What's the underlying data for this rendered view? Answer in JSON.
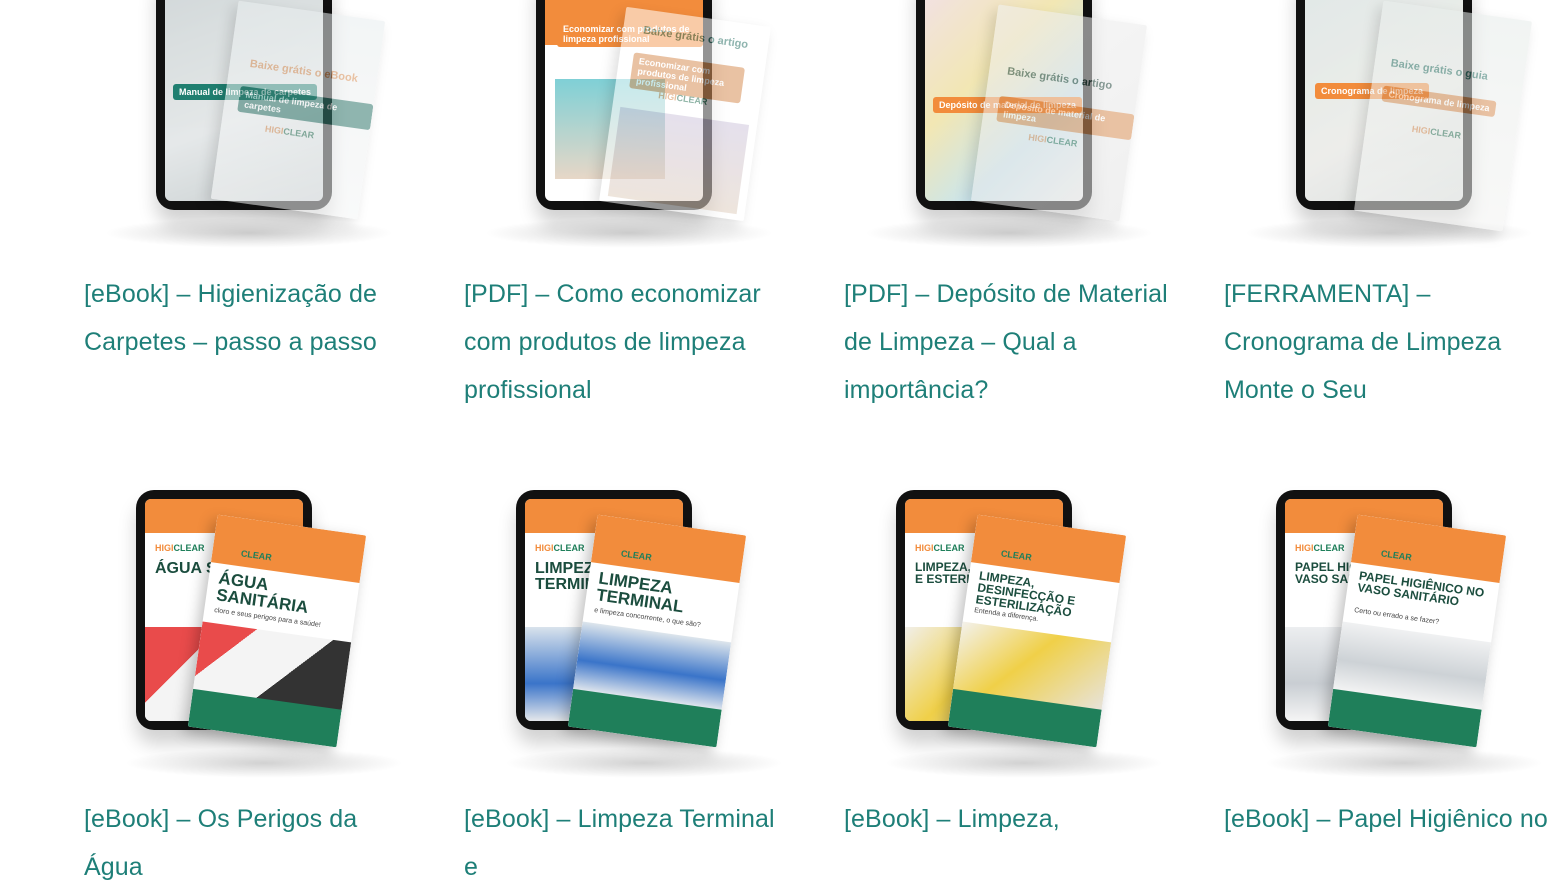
{
  "cards": [
    {
      "title": "[eBook] – Higienização de Carpetes – passo a passo",
      "cover": {
        "headline": "Baixe grátis o eBook",
        "sub": "Manual de limpeza de carpetes",
        "brand_a": "HIGI",
        "brand_b": "CLEAR"
      }
    },
    {
      "title": "[PDF] – Como economizar com produtos de limpeza profissional",
      "cover": {
        "headline": "Baixe grátis o artigo",
        "sub": "Economizar com produtos de limpeza profissional",
        "brand_a": "HIGI",
        "brand_b": "CLEAR"
      }
    },
    {
      "title": "[PDF] – Depósito de Material de Limpeza – Qual a importância?",
      "cover": {
        "headline": "Baixe grátis o artigo",
        "sub": "Depósito de material de limpeza",
        "brand_a": "HIGI",
        "brand_b": "CLEAR"
      }
    },
    {
      "title": "[FERRAMENTA] – Cronograma de Limpeza Monte o Seu",
      "cover": {
        "headline": "Baixe grátis o guia",
        "sub": "Cronograma de limpeza",
        "brand_a": "HIGI",
        "brand_b": "CLEAR"
      }
    },
    {
      "title": "[eBook] – Os Perigos da Água",
      "cover": {
        "headline": "Água Sanitária",
        "sub": "cloro e seus perigos para a saúde!",
        "brand_a": "HIGI",
        "brand_b": "CLEAR"
      }
    },
    {
      "title": "[eBook] – Limpeza Terminal e",
      "cover": {
        "headline": "Limpeza Terminal",
        "sub": "e limpeza concorrente, o que são?",
        "brand_a": "HIGI",
        "brand_b": "CLEAR"
      }
    },
    {
      "title": "[eBook] – Limpeza,",
      "cover": {
        "headline": "Limpeza, Desinfecção e Esterilização",
        "sub": "Entenda a diferença.",
        "brand_a": "HIGI",
        "brand_b": "CLEAR"
      }
    },
    {
      "title": "[eBook] – Papel Higiênico no",
      "cover": {
        "headline": "Papel Higiênico no Vaso Sanitário",
        "sub": "Certo ou errado a se fazer?",
        "brand_a": "HIGI",
        "brand_b": "CLEAR"
      }
    }
  ]
}
